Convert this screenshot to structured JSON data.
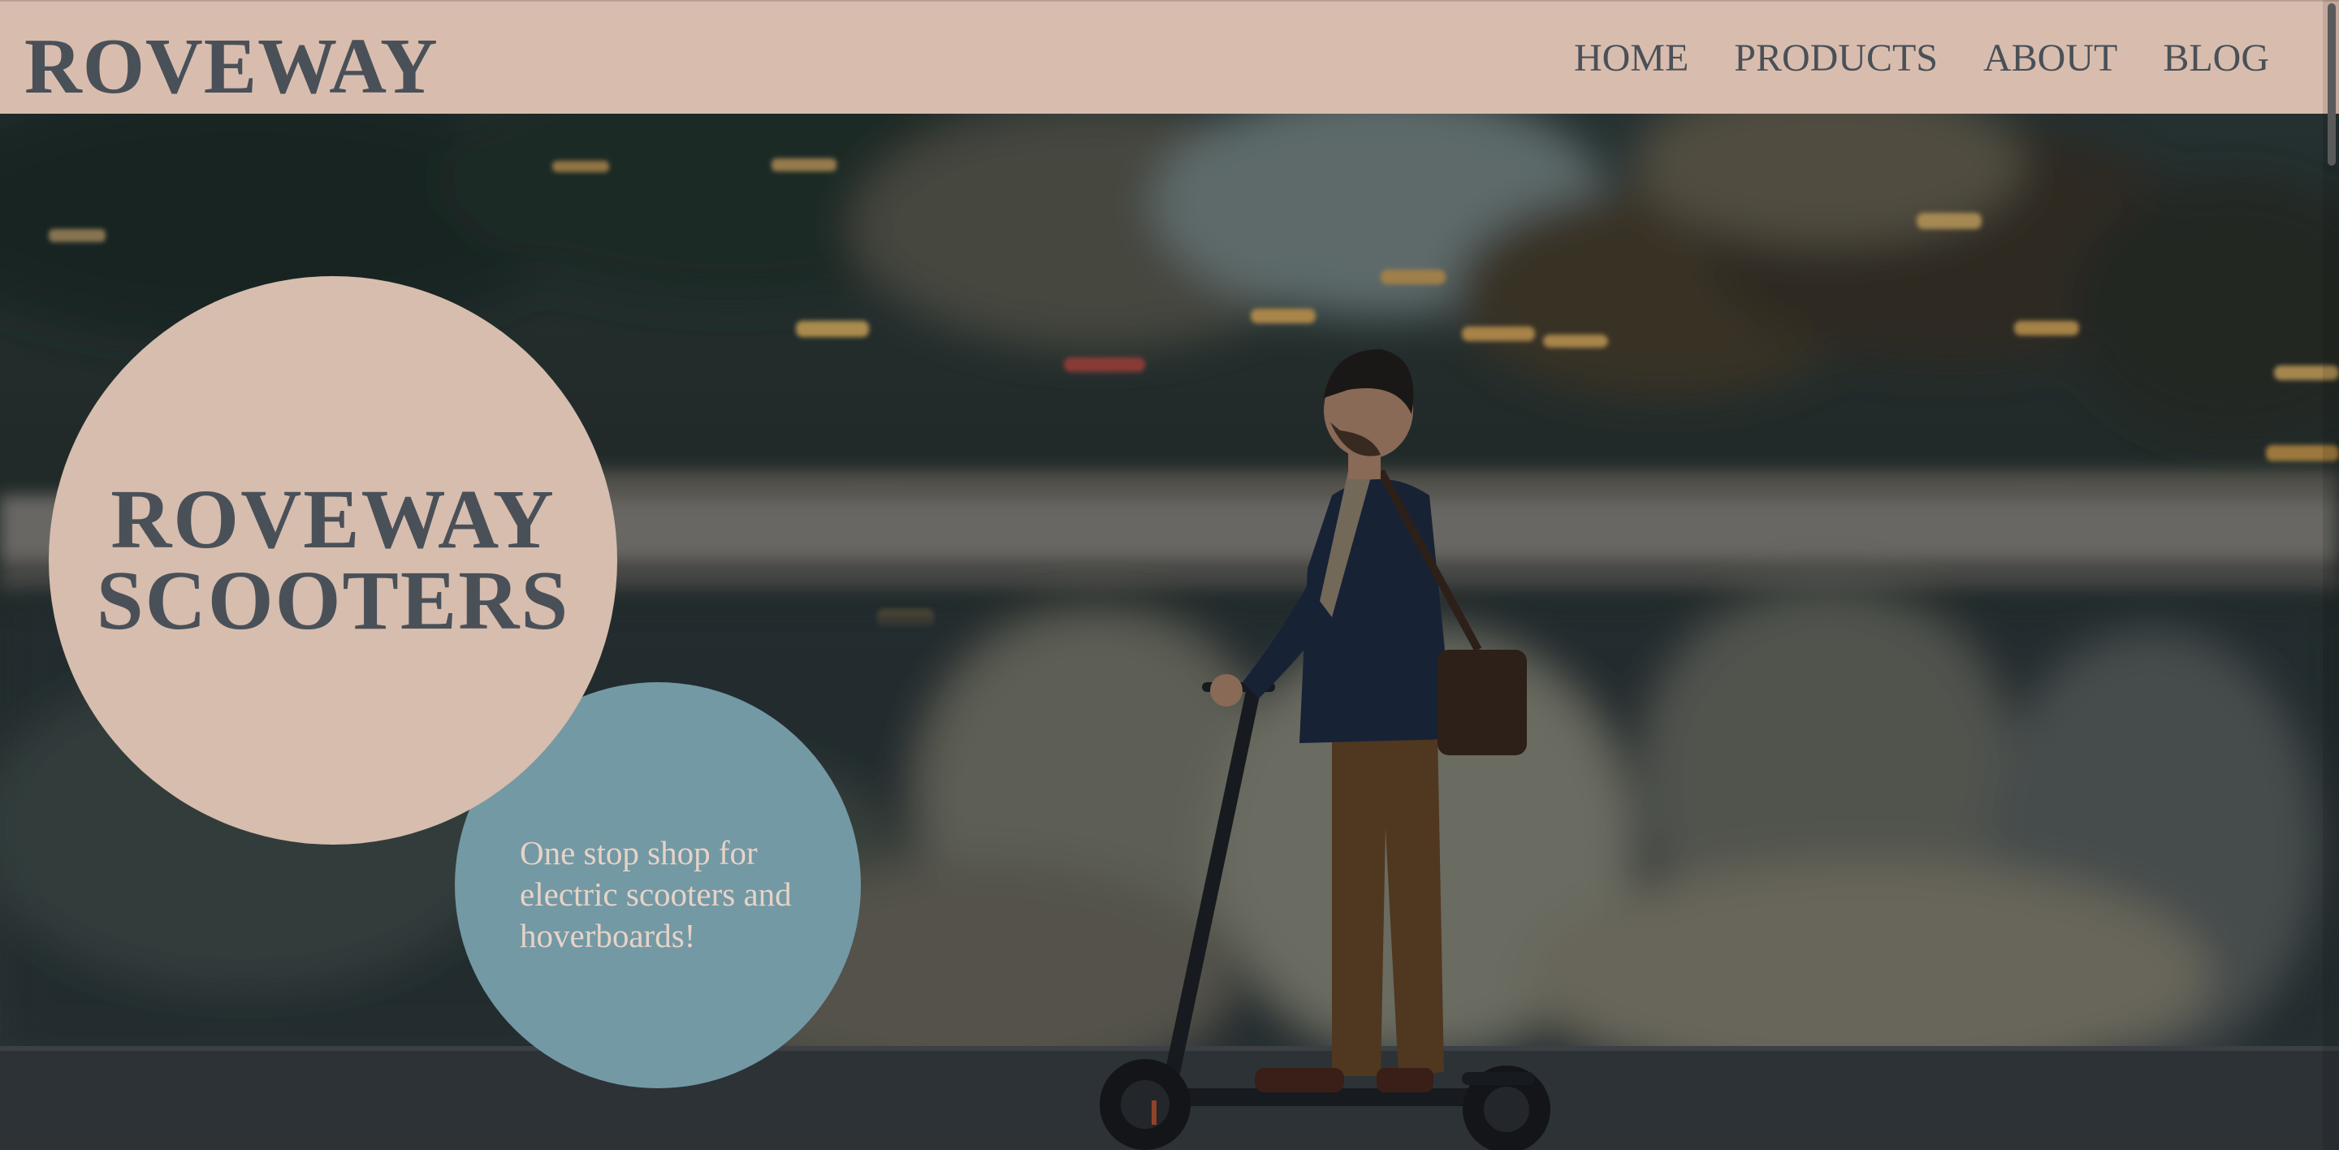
{
  "header": {
    "logo": "ROVEWAY",
    "nav": [
      "HOME",
      "PRODUCTS",
      "ABOUT",
      "BLOG"
    ]
  },
  "hero": {
    "title_line1": "ROVEWAY",
    "title_line2": "SCOOTERS",
    "tagline": "One stop shop for electric scooters and hoverboards!",
    "image": "man riding electric scooter past blurred city lights"
  },
  "colors": {
    "header_bg": "#d8bdae",
    "text_dark": "#4a5058",
    "main_circle": "#d6bdae",
    "accent_circle": "#7399a5",
    "tagline_text": "#e7d3c6"
  }
}
